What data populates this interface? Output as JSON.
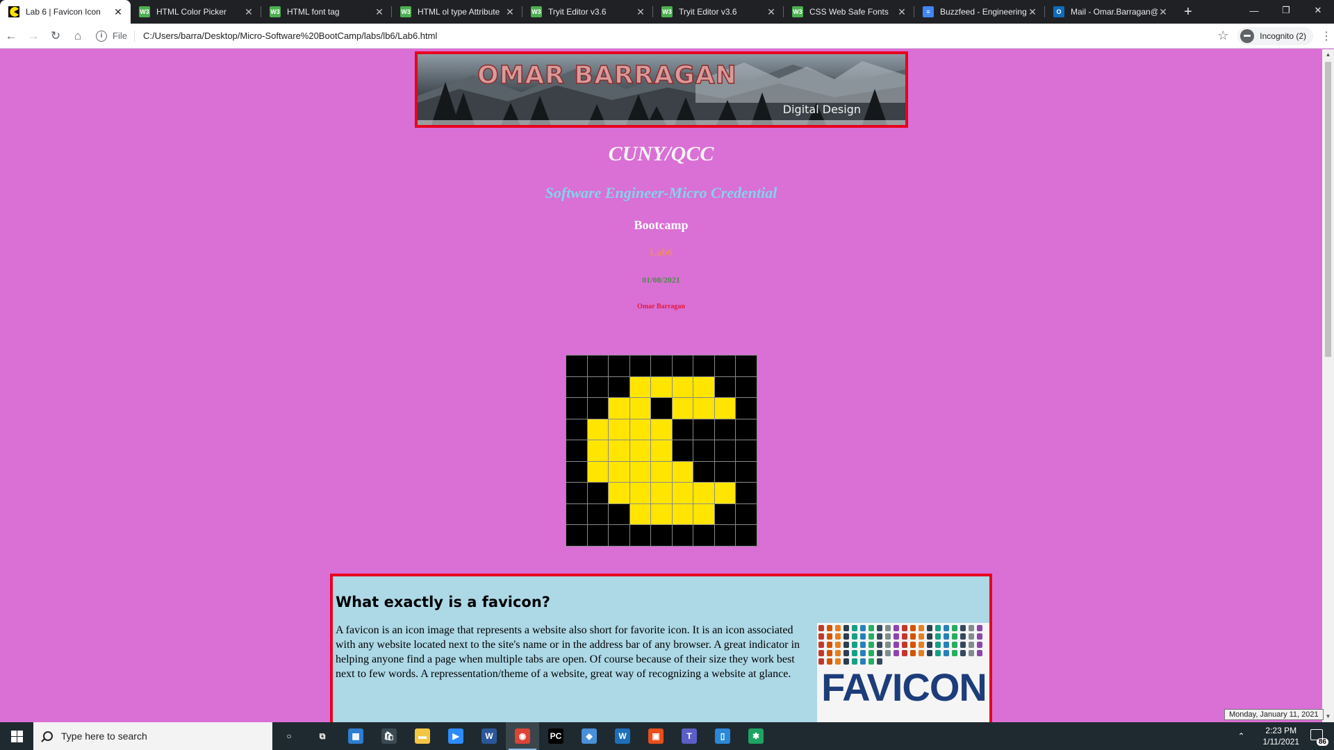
{
  "browser": {
    "tabs": [
      {
        "title": "Lab 6 | Favicon Icon",
        "active": true,
        "icon": "pacman-favicon-icon",
        "color": "#ffe500"
      },
      {
        "title": "HTML Color Picker",
        "active": false,
        "icon": "w3schools-icon",
        "color": "#4caf50"
      },
      {
        "title": "HTML font tag",
        "active": false,
        "icon": "w3schools-icon",
        "color": "#4caf50"
      },
      {
        "title": "HTML ol type Attribute",
        "active": false,
        "icon": "w3schools-icon",
        "color": "#4caf50"
      },
      {
        "title": "Tryit Editor v3.6",
        "active": false,
        "icon": "w3schools-icon",
        "color": "#4caf50"
      },
      {
        "title": "Tryit Editor v3.6",
        "active": false,
        "icon": "w3schools-icon",
        "color": "#4caf50"
      },
      {
        "title": "CSS Web Safe Fonts",
        "active": false,
        "icon": "w3schools-icon",
        "color": "#4caf50"
      },
      {
        "title": "Buzzfeed - Engineering",
        "active": false,
        "icon": "google-docs-icon",
        "color": "#4285f4"
      },
      {
        "title": "Mail - Omar.Barragan@",
        "active": false,
        "icon": "outlook-icon",
        "color": "#0f6cbd"
      }
    ],
    "address": {
      "scheme_label": "File",
      "url": "C:/Users/barra/Desktop/Micro-Software%20BootCamp/labs/lb6/Lab6.html"
    },
    "incognito_label": "Incognito (2)"
  },
  "page": {
    "banner": {
      "name": "OMAR BARRAGAN",
      "tagline": "Digital Design"
    },
    "heading_main": "CUNY/QCC",
    "heading_sub": "Software Engineer-Micro Credential",
    "heading_bootcamp": "Bootcamp",
    "heading_lab": "Lab6",
    "date": "01/08/2021",
    "author": "Omar Barragan",
    "pixel_art": {
      "rows": [
        "000000000",
        "000111100",
        "001101110",
        "011110000",
        "011110000",
        "011111000",
        "001111110",
        "000111100",
        "000000000"
      ],
      "colors": {
        "on": "#ffe500",
        "off": "#000000"
      }
    },
    "info": {
      "title": "What exactly is a favicon?",
      "text": "A favicon is an icon image that represents a website also short for favorite icon. It is an icon associated with any website located next to the site's name or in the address bar of any browser. A great indicator in helping anyone find a page when multiple tabs are open. Of course because of their size they work best next to few words. A repressentation/theme of a website, great way of recognizing a website at glance.",
      "image_word": "FAVICON"
    }
  },
  "taskbar": {
    "search_placeholder": "Type here to search",
    "apps": [
      {
        "name": "cortana-icon",
        "color": "#1f2a30",
        "glyph": "○"
      },
      {
        "name": "task-view-icon",
        "color": "#1f2a30",
        "glyph": "⧉"
      },
      {
        "name": "calendar-icon",
        "color": "#2d7dd2",
        "glyph": "▦"
      },
      {
        "name": "store-icon",
        "color": "#3b4a52",
        "glyph": "🛍"
      },
      {
        "name": "file-explorer-icon",
        "color": "#f4c542",
        "glyph": "▬"
      },
      {
        "name": "zoom-icon",
        "color": "#2d8cff",
        "glyph": "▶"
      },
      {
        "name": "word-icon",
        "color": "#2b579a",
        "glyph": "W"
      },
      {
        "name": "chrome-icon",
        "color": "#db4437",
        "glyph": "◉",
        "active": true
      },
      {
        "name": "pycharm-icon",
        "color": "#000000",
        "glyph": "PC"
      },
      {
        "name": "virtualbox-icon",
        "color": "#4a90d9",
        "glyph": "◆"
      },
      {
        "name": "webex-icon",
        "color": "#1d6fb8",
        "glyph": "W"
      },
      {
        "name": "office-icon",
        "color": "#e94e1b",
        "glyph": "▣"
      },
      {
        "name": "teams-icon",
        "color": "#5b5fc7",
        "glyph": "T"
      },
      {
        "name": "phone-icon",
        "color": "#2b88d8",
        "glyph": "▯"
      },
      {
        "name": "app-green-icon",
        "color": "#1ea362",
        "glyph": "✱"
      }
    ],
    "time": "2:23 PM",
    "date": "1/11/2021",
    "notification_count": "86",
    "date_tooltip": "Monday, January 11, 2021"
  }
}
